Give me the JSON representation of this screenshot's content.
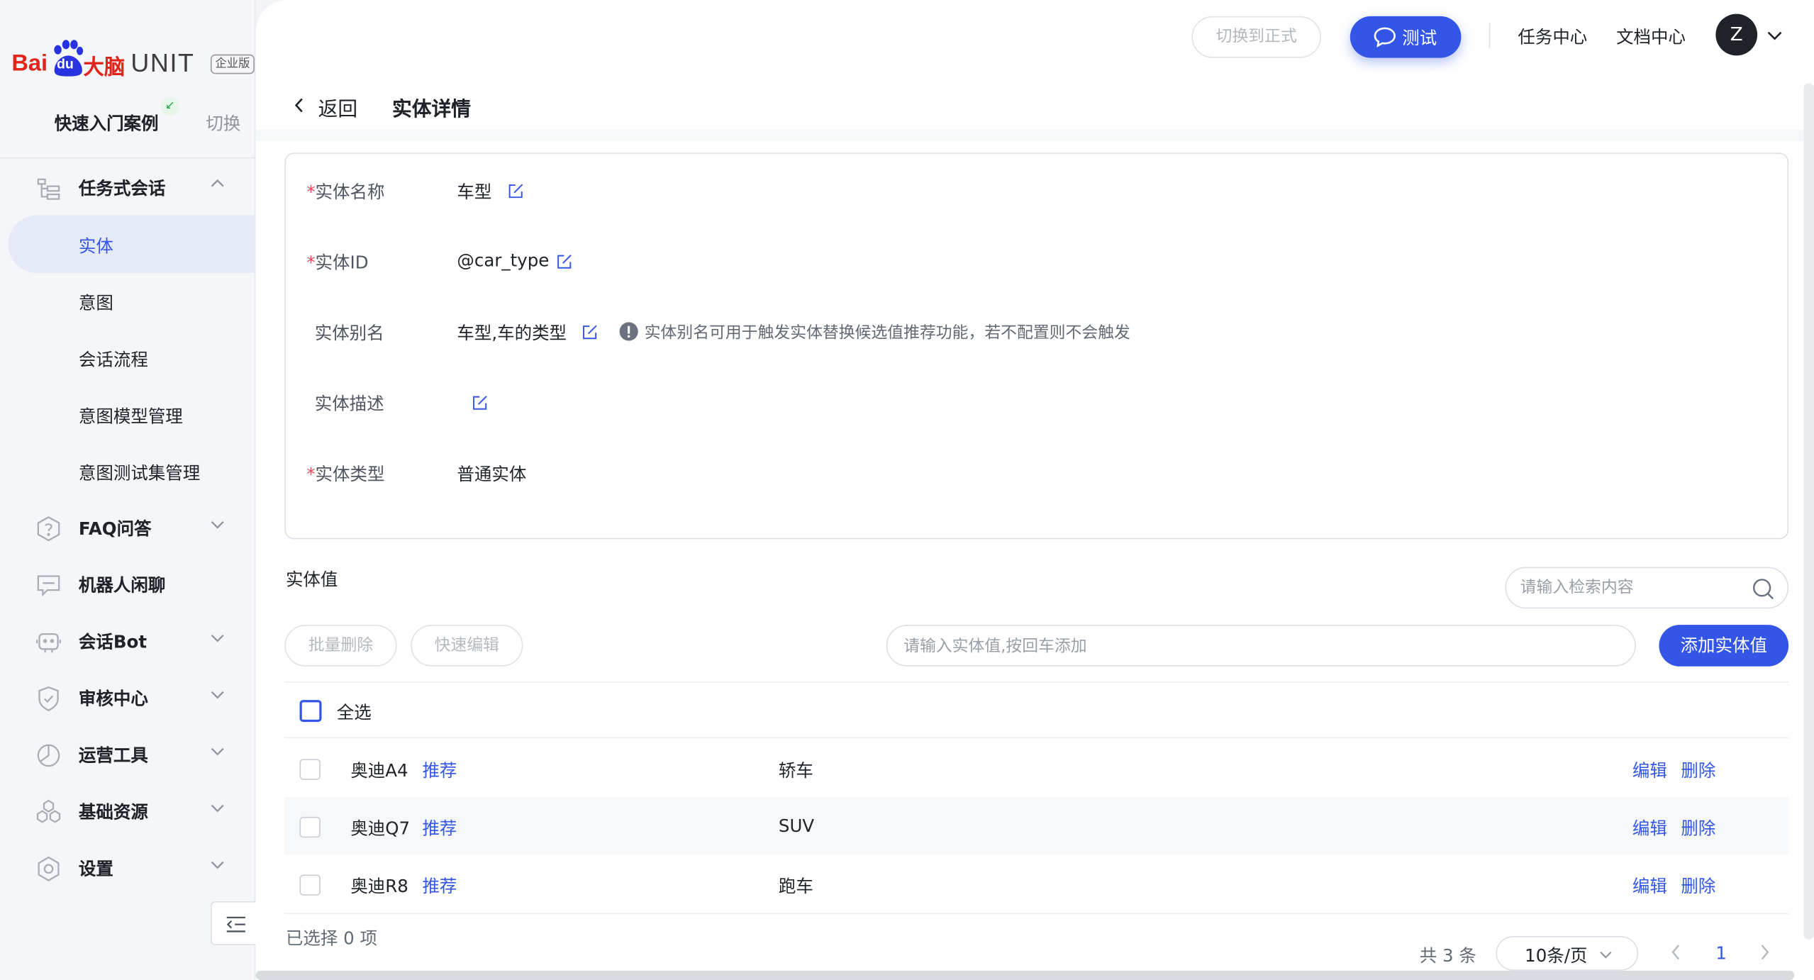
{
  "brand": {
    "logo_bai": "Bai",
    "logo_du": "du",
    "logo_danao": "大脑",
    "product": "UNIT",
    "edition": "企业版",
    "red_color": "#e1251b"
  },
  "sidebar": {
    "quick_case_label": "快速入门案例",
    "switch_label": "切换",
    "groups": [
      {
        "label": "任务式会话",
        "icon": "task-dialog-icon",
        "expanded": true,
        "children": [
          "实体",
          "意图",
          "会话流程",
          "意图模型管理",
          "意图测试集管理"
        ],
        "active_child": "实体"
      },
      {
        "label": "FAQ问答",
        "icon": "faq-icon"
      },
      {
        "label": "机器人闲聊",
        "icon": "chat-icon"
      },
      {
        "label": "会话Bot",
        "icon": "bot-icon"
      },
      {
        "label": "审核中心",
        "icon": "shield-icon"
      },
      {
        "label": "运营工具",
        "icon": "operation-icon"
      },
      {
        "label": "基础资源",
        "icon": "resource-icon"
      },
      {
        "label": "设置",
        "icon": "settings-icon"
      }
    ]
  },
  "topbar": {
    "switch_formal": "切换到正式",
    "test_button": "测试",
    "task_center": "任务中心",
    "doc_center": "文档中心",
    "avatar_initial": "Z"
  },
  "header": {
    "back": "返回",
    "title": "实体详情"
  },
  "entity": {
    "name_label": "实体名称",
    "name_value": "车型",
    "id_label": "实体ID",
    "id_value": "@car_type",
    "alias_label": "实体别名",
    "alias_value": "车型,车的类型",
    "alias_hint": "实体别名可用于触发实体替换候选值推荐功能，若不配置则不会触发",
    "desc_label": "实体描述",
    "desc_value": "",
    "type_label": "实体类型",
    "type_value": "普通实体",
    "required_mark": "*"
  },
  "values_section": {
    "title": "实体值",
    "search_placeholder": "请输入检索内容",
    "batch_delete": "批量删除",
    "quick_edit": "快速编辑",
    "input_placeholder": "请输入实体值,按回车添加",
    "add_button": "添加实体值",
    "select_all": "全选"
  },
  "rows": [
    {
      "name": "奥迪A4",
      "tag": "推荐",
      "synonym": "轿车",
      "edit": "编辑",
      "delete": "删除"
    },
    {
      "name": "奥迪Q7",
      "tag": "推荐",
      "synonym": "SUV",
      "edit": "编辑",
      "delete": "删除"
    },
    {
      "name": "奥迪R8",
      "tag": "推荐",
      "synonym": "跑车",
      "edit": "编辑",
      "delete": "删除"
    }
  ],
  "footer": {
    "selected": "已选择 0 项",
    "total": "共 3 条",
    "page_size": "10条/页",
    "current_page": "1"
  },
  "colors": {
    "primary": "#3456e6",
    "required": "#e34d59",
    "sidebar_bg": "#f5f6f9",
    "active_item_bg": "#e5e9f8"
  }
}
